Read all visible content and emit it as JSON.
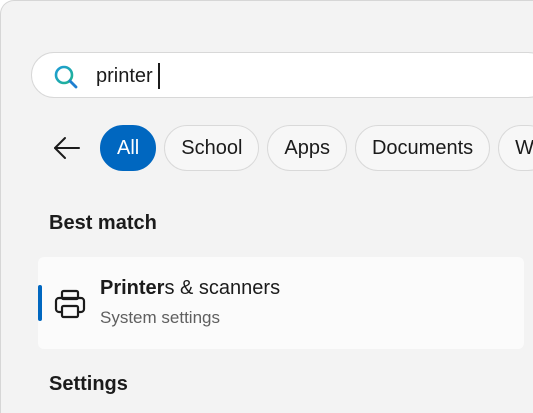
{
  "search": {
    "value": "printer",
    "icon": "search-icon"
  },
  "filters": {
    "back_icon": "back-arrow-icon",
    "chips": [
      {
        "label": "All",
        "active": true
      },
      {
        "label": "School",
        "active": false
      },
      {
        "label": "Apps",
        "active": false
      },
      {
        "label": "Documents",
        "active": false
      },
      {
        "label": "W",
        "active": false
      }
    ]
  },
  "best_match": {
    "heading": "Best match",
    "result": {
      "icon": "printer-icon",
      "title_match": "Printer",
      "title_rest": "s & scanners",
      "subtitle": "System settings"
    }
  },
  "settings": {
    "heading": "Settings"
  },
  "colors": {
    "accent": "#0067c0",
    "panel_bg": "#f3f3f3",
    "card_bg": "#fbfbfb"
  }
}
